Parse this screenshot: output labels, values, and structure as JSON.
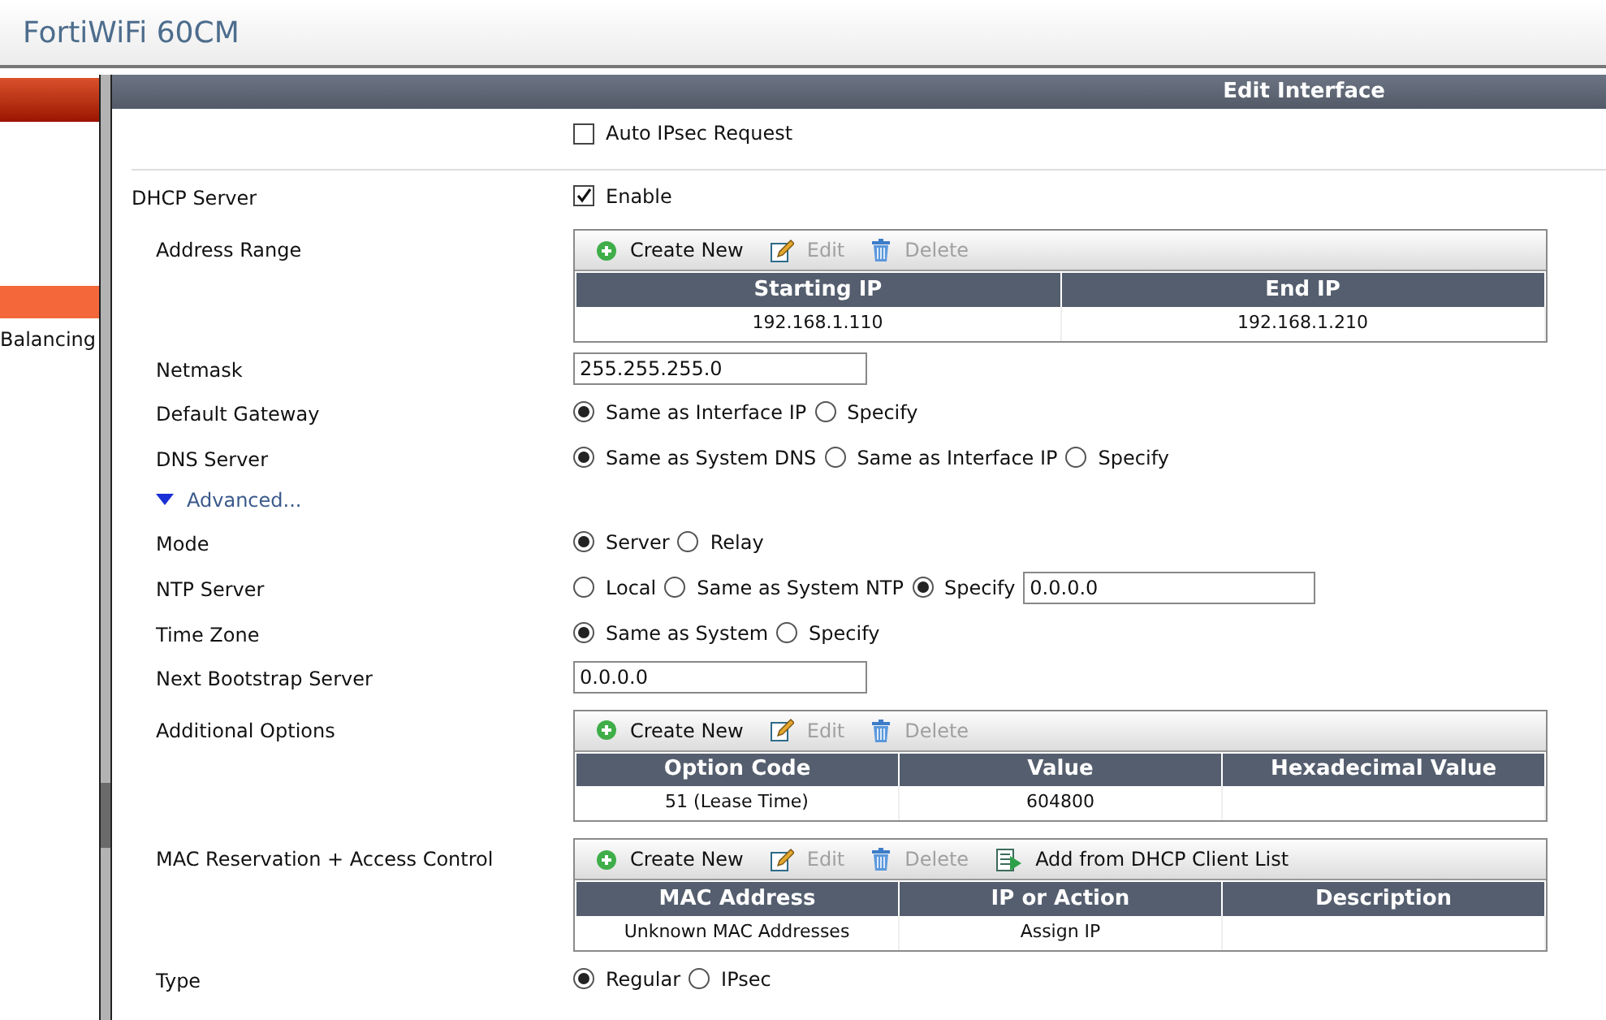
{
  "header": {
    "title": "FortiWiFi 60CM"
  },
  "sidebar": {
    "items": [
      {
        "selected": true
      },
      {
        "label": "Balancing",
        "selected": false
      }
    ]
  },
  "panel": {
    "title": "Edit Interface",
    "auto_ipsec": {
      "label": "Auto IPsec Request",
      "checked": false
    },
    "dhcp": {
      "label": "DHCP Server",
      "enable_label": "Enable",
      "checked": true,
      "fields": [
        {
          "kind": "table",
          "label": "Address Range",
          "toolbar": [
            {
              "label": "Create New",
              "kind": "add",
              "disabled": false
            },
            {
              "label": "Edit",
              "kind": "edit",
              "disabled": true
            },
            {
              "label": "Delete",
              "kind": "delete",
              "disabled": true
            }
          ],
          "columns": [
            "Starting IP",
            "End IP"
          ],
          "rows": [
            [
              "192.168.1.110",
              "192.168.1.210"
            ]
          ]
        },
        {
          "kind": "input",
          "label": "Netmask",
          "value": "255.255.255.0"
        },
        {
          "kind": "radios",
          "label": "Default Gateway",
          "options": [
            {
              "label": "Same as Interface IP",
              "selected": true
            },
            {
              "label": "Specify",
              "selected": false
            }
          ]
        },
        {
          "kind": "radios",
          "label": "DNS Server",
          "options": [
            {
              "label": "Same as System DNS",
              "selected": true
            },
            {
              "label": "Same as Interface IP",
              "selected": false
            },
            {
              "label": "Specify",
              "selected": false
            }
          ]
        },
        {
          "kind": "toggle",
          "label": "Advanced...",
          "expanded": true
        },
        {
          "kind": "radios",
          "label": "Mode",
          "options": [
            {
              "label": "Server",
              "selected": true
            },
            {
              "label": "Relay",
              "selected": false
            }
          ]
        },
        {
          "kind": "radios",
          "label": "NTP Server",
          "options": [
            {
              "label": "Local",
              "selected": false
            },
            {
              "label": "Same as System NTP",
              "selected": false
            },
            {
              "label": "Specify",
              "selected": true
            }
          ],
          "value": "0.0.0.0"
        },
        {
          "kind": "radios",
          "label": "Time Zone",
          "options": [
            {
              "label": "Same as System",
              "selected": true
            },
            {
              "label": "Specify",
              "selected": false
            }
          ]
        },
        {
          "kind": "input",
          "label": "Next Bootstrap Server",
          "value": "0.0.0.0"
        },
        {
          "kind": "table",
          "label": "Additional Options",
          "toolbar": [
            {
              "label": "Create New",
              "kind": "add",
              "disabled": false
            },
            {
              "label": "Edit",
              "kind": "edit",
              "disabled": true
            },
            {
              "label": "Delete",
              "kind": "delete",
              "disabled": true
            }
          ],
          "columns": [
            "Option Code",
            "Value",
            "Hexadecimal Value"
          ],
          "rows": [
            [
              "51 (Lease Time)",
              "604800"
            ]
          ]
        },
        {
          "kind": "table",
          "label": "MAC Reservation + Access Control",
          "toolbar": [
            {
              "label": "Create New",
              "kind": "add",
              "disabled": false
            },
            {
              "label": "Edit",
              "kind": "edit",
              "disabled": true
            },
            {
              "label": "Delete",
              "kind": "delete",
              "disabled": true
            },
            {
              "label": "Add from DHCP Client List",
              "kind": "import",
              "disabled": false
            }
          ],
          "columns": [
            "MAC Address",
            "IP or Action",
            "Description"
          ],
          "rows": [
            [
              "Unknown MAC Addresses",
              "Assign IP"
            ]
          ]
        },
        {
          "kind": "radios",
          "label": "Type",
          "options": [
            {
              "label": "Regular",
              "selected": true
            },
            {
              "label": "IPsec",
              "selected": false
            }
          ]
        }
      ]
    }
  }
}
